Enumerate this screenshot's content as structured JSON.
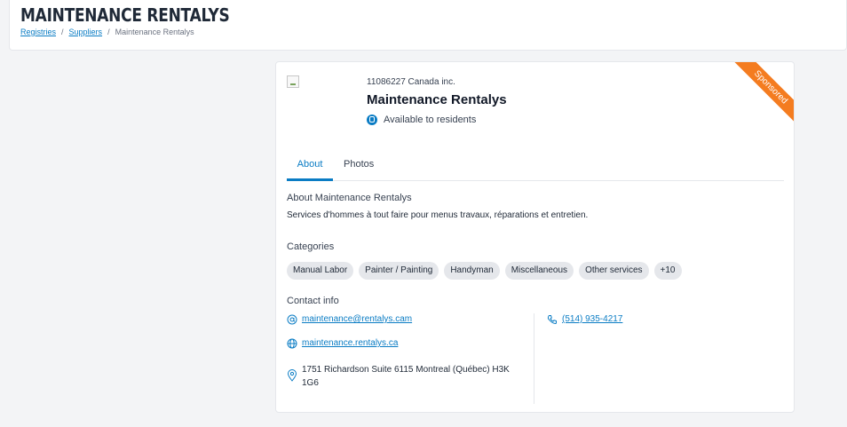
{
  "header": {
    "title": "MAINTENANCE RENTALYS",
    "breadcrumb": [
      "Registries",
      "Suppliers",
      "Maintenance Rentalys"
    ],
    "separator": "/"
  },
  "supplier": {
    "company": "11086227 Canada inc.",
    "name": "Maintenance Rentalys",
    "availability": "Available to residents",
    "sponsored_label": "Sponsored"
  },
  "tabs": [
    {
      "label": "About",
      "active": true
    },
    {
      "label": "Photos",
      "active": false
    }
  ],
  "about": {
    "heading": "About Maintenance Rentalys",
    "text": "Services d'hommes à tout faire pour menus travaux, réparations et entretien."
  },
  "categories": {
    "heading": "Categories",
    "items": [
      "Manual Labor",
      "Painter / Painting",
      "Handyman",
      "Miscellaneous",
      "Other services",
      "+10"
    ]
  },
  "contact": {
    "heading": "Contact info",
    "email": "maintenance@rentalys.cam",
    "website": "maintenance.rentalys.ca",
    "address": "1751 Richardson Suite 6115 Montreal (Québec) H3K 1G6",
    "phone": "(514) 935-4217"
  },
  "colors": {
    "accent": "#0a7cc4",
    "ribbon": "#f47c20",
    "chip_bg": "#e5e7eb"
  },
  "icons": [
    "broken-image-icon",
    "resident-badge-icon",
    "email-icon",
    "globe-icon",
    "map-pin-icon",
    "phone-icon"
  ]
}
